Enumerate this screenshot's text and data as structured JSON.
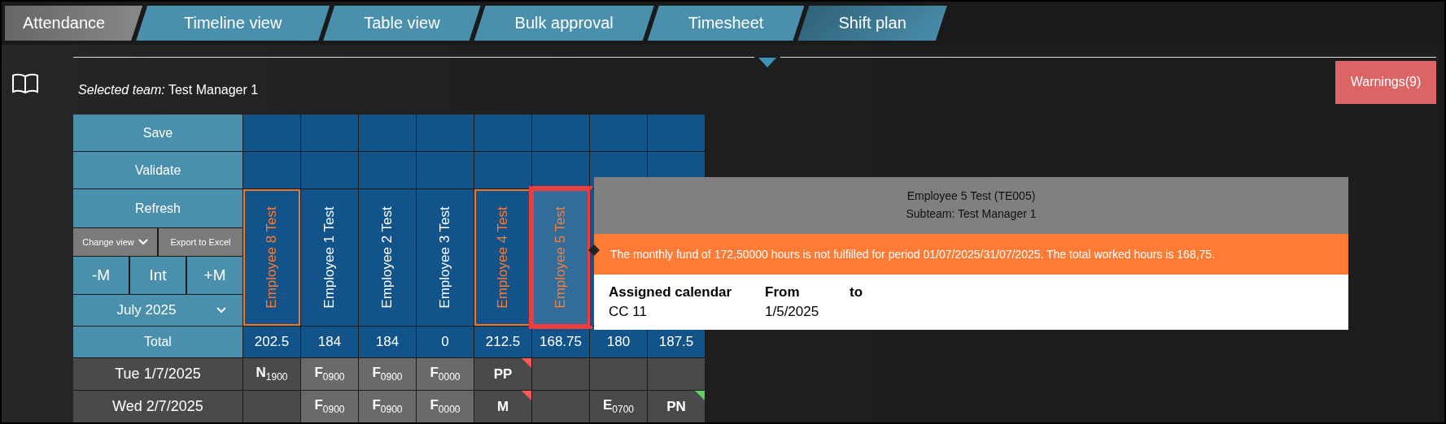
{
  "tabs": [
    {
      "label": "Attendance",
      "kind": "module",
      "selected": false
    },
    {
      "label": "Timeline view",
      "kind": "view",
      "selected": false
    },
    {
      "label": "Table view",
      "kind": "view",
      "selected": false
    },
    {
      "label": "Bulk approval",
      "kind": "view",
      "selected": false
    },
    {
      "label": "Timesheet",
      "kind": "view",
      "selected": false
    },
    {
      "label": "Shift plan",
      "kind": "view",
      "selected": true
    }
  ],
  "selected_team": {
    "label": "Selected team:",
    "value": "Test Manager 1"
  },
  "warnings_button": "Warnings(9)",
  "controls": {
    "save": "Save",
    "validate": "Validate",
    "refresh": "Refresh",
    "change_view": "Change view",
    "export": "Export to Excel",
    "minus_month": "-M",
    "interval": "Int",
    "plus_month": "+M",
    "month": "July 2025",
    "total_label": "Total"
  },
  "employees": [
    {
      "name": "Employee 8 Test",
      "total": "202.5",
      "warning": true,
      "selected": false
    },
    {
      "name": "Employee 1 Test",
      "total": "184",
      "warning": false,
      "selected": false
    },
    {
      "name": "Employee 2 Test",
      "total": "184",
      "warning": false,
      "selected": false
    },
    {
      "name": "Employee 3 Test",
      "total": "0",
      "warning": false,
      "selected": false
    },
    {
      "name": "Employee 4 Test",
      "total": "212.5",
      "warning": true,
      "selected": false
    },
    {
      "name": "Employee 5 Test",
      "total": "168.75",
      "warning": true,
      "selected": true
    },
    {
      "total": "180"
    },
    {
      "total": "187.5"
    }
  ],
  "days": [
    {
      "label": "Tue 1/7/2025",
      "cells": [
        {
          "code": "N$_{1900}$",
          "shaded": false
        },
        {
          "code": "F$_{0900}$",
          "shaded": true
        },
        {
          "code": "F$_{0900}$",
          "shaded": true
        },
        {
          "code": "F$_{0000}$",
          "shaded": true
        },
        {
          "code": "PP",
          "shaded": false,
          "color": "#ff5a5a"
        },
        {
          "shaded": false
        },
        {
          "shaded": false
        },
        {
          "shaded": false
        }
      ]
    },
    {
      "label": "Wed 2/7/2025",
      "cells": [
        {
          "shaded": false
        },
        {
          "code": "F$_{0900}$",
          "shaded": true
        },
        {
          "code": "F$_{0900}$",
          "shaded": true
        },
        {
          "code": "F$_{0000}$",
          "shaded": true
        },
        {
          "code": "M",
          "shaded": false,
          "color": "#ff5a5a"
        },
        {
          "shaded": false
        },
        {
          "code": "E$_{0700}$",
          "shaded": false
        },
        {
          "code": "PN",
          "shaded": false,
          "color": "#5ed05e"
        }
      ]
    }
  ],
  "tooltip": {
    "title": "Employee 5 Test (TE005)",
    "subtitle": "Subteam: Test Manager 1",
    "warning": "The monthly fund of 172,50000 hours is not fulfilled for period 01/07/2025/31/07/2025. The total worked hours is 168,75.",
    "columns": [
      "Assigned calendar",
      "From",
      "to"
    ],
    "rows": [
      [
        "CC 11",
        "1/5/2025",
        ""
      ]
    ]
  }
}
